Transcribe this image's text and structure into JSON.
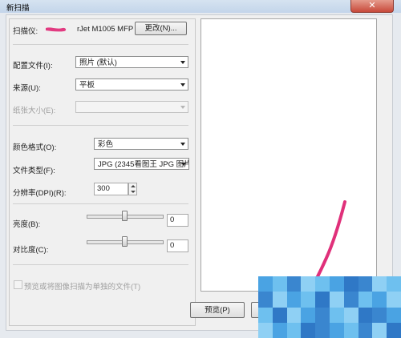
{
  "window": {
    "title": "新扫描",
    "close_glyph": "✕"
  },
  "scanner": {
    "label": "扫描仪:",
    "device_partial": "rJet M1005 MFP",
    "change_button": "更改(N)..."
  },
  "fields": {
    "profile": {
      "label": "配置文件(I):",
      "value": "照片 (默认)"
    },
    "source": {
      "label": "来源(U):",
      "value": "平板"
    },
    "paper_size": {
      "label": "纸张大小(E):",
      "value": ""
    },
    "color_format": {
      "label": "颜色格式(O):",
      "value": "彩色"
    },
    "file_type": {
      "label": "文件类型(F):",
      "value": "JPG (2345看图王 JPG 图片"
    },
    "resolution": {
      "label": "分辨率(DPI)(R):",
      "value": "300"
    },
    "brightness": {
      "label": "亮度(B):",
      "value": "0",
      "level": 0
    },
    "contrast": {
      "label": "对比度(C):",
      "value": "0",
      "level": 0
    }
  },
  "checkbox": {
    "label": "预览或将图像扫描为单独的文件(T)",
    "checked": false,
    "enabled": false
  },
  "buttons": {
    "preview": "预览(P)"
  },
  "colors": {
    "annotation_stroke": "#e0307a",
    "mosaic": [
      "#4aa3e3",
      "#6ec0ef",
      "#3a86cf",
      "#8fd0f4",
      "#2f78c6"
    ]
  }
}
